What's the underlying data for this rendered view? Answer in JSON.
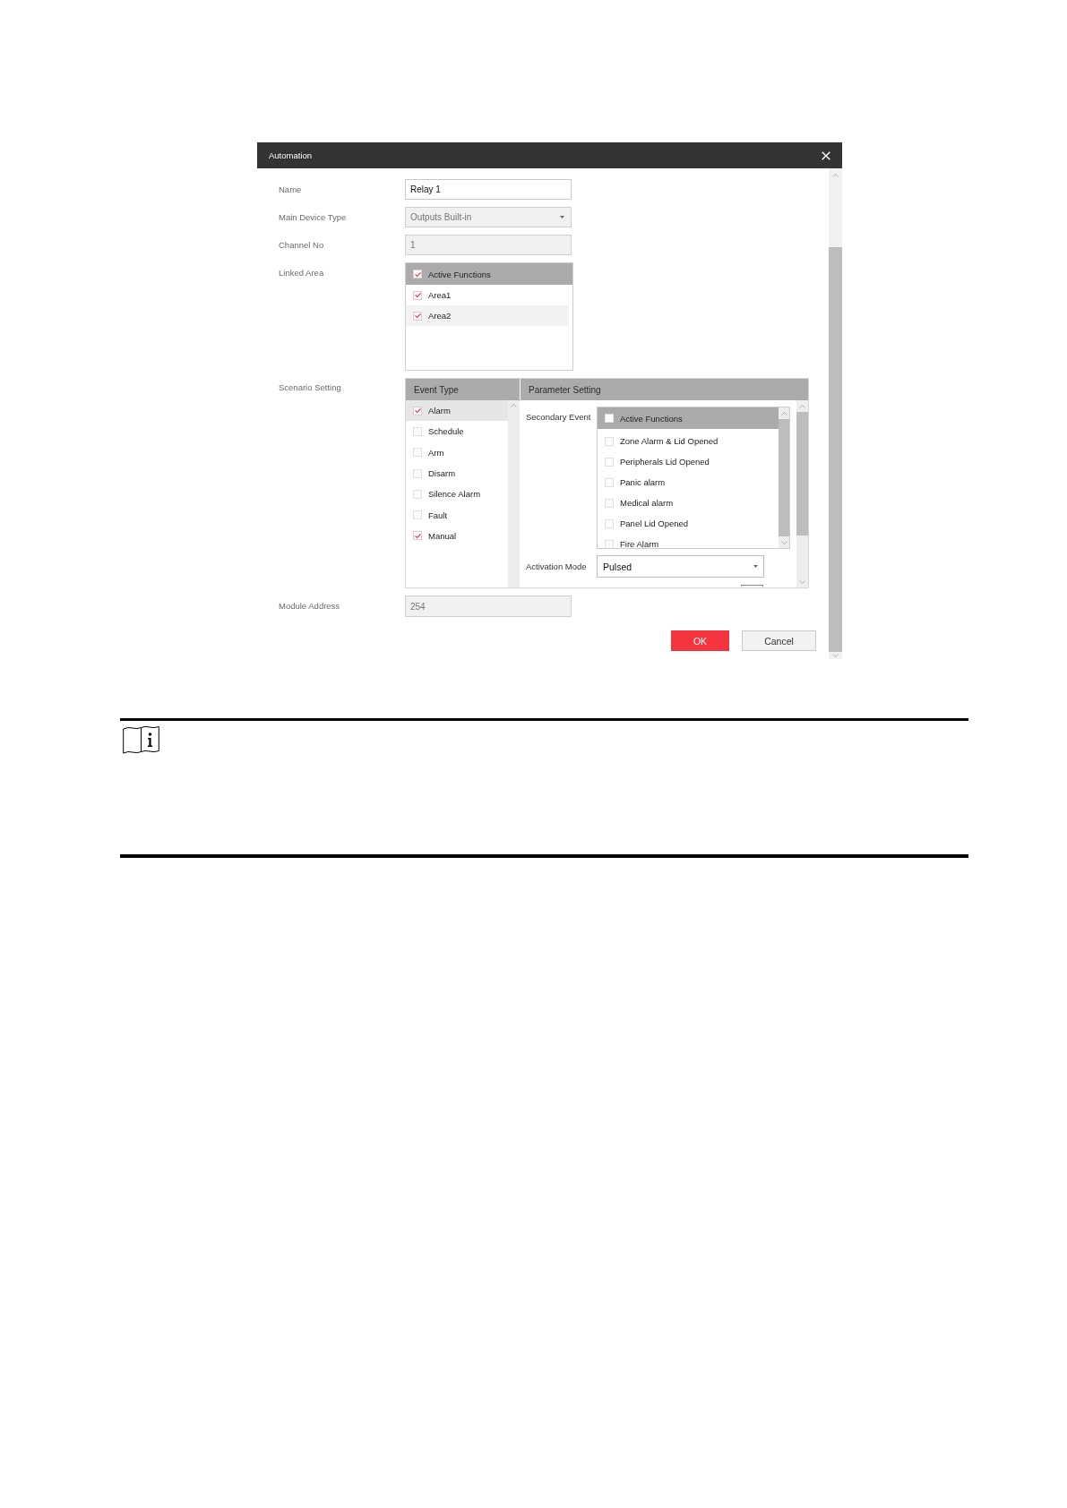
{
  "dialog": {
    "title": "Automation"
  },
  "fields": [
    {
      "kind": "text",
      "label": "Name",
      "value": "Relay 1",
      "disabled": false
    },
    {
      "kind": "select",
      "label": "Main Device Type",
      "value": "Outputs Built-in",
      "disabled": true
    },
    {
      "kind": "text",
      "label": "Channel No",
      "value": "1",
      "disabled": true
    }
  ],
  "linked_area": {
    "label": "Linked Area",
    "header": {
      "label": "Active Functions",
      "checked": true
    },
    "items": [
      {
        "label": "Area1",
        "checked": true,
        "selected": false
      },
      {
        "label": "Area2",
        "checked": true,
        "selected": true
      }
    ]
  },
  "scenario": {
    "label": "Scenario Setting",
    "event_type": {
      "heading": "Event Type",
      "items": [
        {
          "label": "Alarm",
          "checked": true,
          "selected": true
        },
        {
          "label": "Schedule",
          "checked": false,
          "selected": false
        },
        {
          "label": "Arm",
          "checked": false,
          "selected": false
        },
        {
          "label": "Disarm",
          "checked": false,
          "selected": false
        },
        {
          "label": "Silence Alarm",
          "checked": false,
          "selected": false
        },
        {
          "label": "Fault",
          "checked": false,
          "selected": false
        },
        {
          "label": "Manual",
          "checked": true,
          "selected": false
        }
      ]
    },
    "parameter_setting": {
      "heading": "Parameter Setting",
      "secondary_event": {
        "label": "Secondary Event",
        "header": {
          "label": "Active Functions",
          "checked": false
        },
        "items": [
          {
            "label": "Zone Alarm & Lid Opened",
            "checked": false
          },
          {
            "label": "Peripherals Lid Opened",
            "checked": false
          },
          {
            "label": "Panic alarm",
            "checked": false
          },
          {
            "label": "Medical alarm",
            "checked": false
          },
          {
            "label": "Panel Lid Opened",
            "checked": false
          },
          {
            "label": "Fire Alarm",
            "checked": false
          }
        ]
      },
      "activation_mode": {
        "label": "Activation Mode",
        "value": "Pulsed"
      }
    }
  },
  "module_address": {
    "label": "Module Address",
    "value": "254",
    "disabled": true
  },
  "buttons": [
    {
      "label": "OK",
      "kind": "primary"
    },
    {
      "label": "Cancel",
      "kind": "secondary"
    }
  ]
}
